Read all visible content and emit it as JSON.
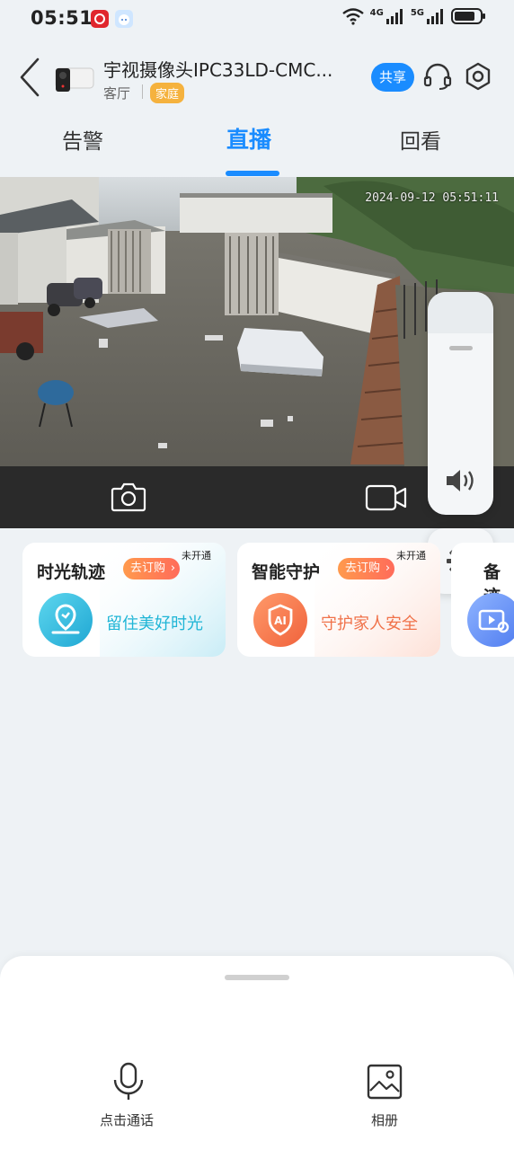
{
  "status": {
    "time": "05:51",
    "network1": "4G",
    "network2": "5G"
  },
  "header": {
    "title": "宇视摄像头IPC33LD-CMC...",
    "room": "客厅",
    "tag": "家庭",
    "share_label": "共享"
  },
  "tabs": [
    {
      "label": "告警"
    },
    {
      "label": "直播",
      "active": true
    },
    {
      "label": "回看"
    }
  ],
  "video": {
    "osd_timestamp": "2024-09-12 05:51:11"
  },
  "cards": [
    {
      "title": "时光轨迹",
      "buy_label": "去订购",
      "badge": "未开通",
      "desc": "留住美好时光",
      "accent": "#1fb5d6"
    },
    {
      "title": "智能守护",
      "buy_label": "去订购",
      "badge": "未开通",
      "desc": "守护家人安全",
      "accent": "#f0724a"
    },
    {
      "title": "备迹"
    }
  ],
  "bottom": {
    "talk_label": "点击通话",
    "album_label": "相册"
  },
  "colors": {
    "accent": "#1a8cff",
    "tag": "#f5b23e"
  }
}
